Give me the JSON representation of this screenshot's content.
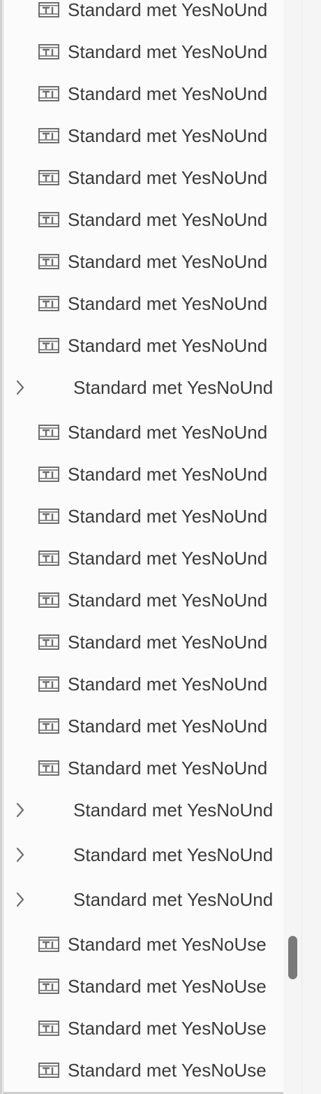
{
  "tree": {
    "rows": [
      {
        "type": "field",
        "label": "Standard met YesNoUnd",
        "icon": "text-field-icon"
      },
      {
        "type": "field",
        "label": "Standard met YesNoUnd",
        "icon": "text-field-icon"
      },
      {
        "type": "field",
        "label": "Standard met YesNoUnd",
        "icon": "text-field-icon"
      },
      {
        "type": "field",
        "label": "Standard met YesNoUnd",
        "icon": "text-field-icon"
      },
      {
        "type": "field",
        "label": "Standard met YesNoUnd",
        "icon": "text-field-icon"
      },
      {
        "type": "field",
        "label": "Standard met YesNoUnd",
        "icon": "text-field-icon"
      },
      {
        "type": "field",
        "label": "Standard met YesNoUnd",
        "icon": "text-field-icon"
      },
      {
        "type": "field",
        "label": "Standard met YesNoUnd",
        "icon": "text-field-icon"
      },
      {
        "type": "field",
        "label": "Standard met YesNoUnd",
        "icon": "text-field-icon"
      },
      {
        "type": "group",
        "label": "Standard met YesNoUnd",
        "icon": "chevron-right-icon"
      },
      {
        "type": "field",
        "label": "Standard met YesNoUnd",
        "icon": "text-field-icon"
      },
      {
        "type": "field",
        "label": "Standard met YesNoUnd",
        "icon": "text-field-icon"
      },
      {
        "type": "field",
        "label": "Standard met YesNoUnd",
        "icon": "text-field-icon"
      },
      {
        "type": "field",
        "label": "Standard met YesNoUnd",
        "icon": "text-field-icon"
      },
      {
        "type": "field",
        "label": "Standard met YesNoUnd",
        "icon": "text-field-icon"
      },
      {
        "type": "field",
        "label": "Standard met YesNoUnd",
        "icon": "text-field-icon"
      },
      {
        "type": "field",
        "label": "Standard met YesNoUnd",
        "icon": "text-field-icon"
      },
      {
        "type": "field",
        "label": "Standard met YesNoUnd",
        "icon": "text-field-icon"
      },
      {
        "type": "field",
        "label": "Standard met YesNoUnd",
        "icon": "text-field-icon"
      },
      {
        "type": "group",
        "label": "Standard met YesNoUnd",
        "icon": "chevron-right-icon"
      },
      {
        "type": "group",
        "label": "Standard met YesNoUnd",
        "icon": "chevron-right-icon"
      },
      {
        "type": "group",
        "label": "Standard met YesNoUnd",
        "icon": "chevron-right-icon"
      },
      {
        "type": "field",
        "label": "Standard met YesNoUse",
        "icon": "text-field-icon"
      },
      {
        "type": "field",
        "label": "Standard met YesNoUse",
        "icon": "text-field-icon"
      },
      {
        "type": "field",
        "label": "Standard met YesNoUse",
        "icon": "text-field-icon"
      },
      {
        "type": "field",
        "label": "Standard met YesNoUse",
        "icon": "text-field-icon"
      }
    ]
  },
  "colors": {
    "text": "#3b3b3b",
    "icon": "#6e6e6e",
    "panel_bg": "#fbfbfb",
    "scroll_thumb": "#7a7a7a"
  }
}
